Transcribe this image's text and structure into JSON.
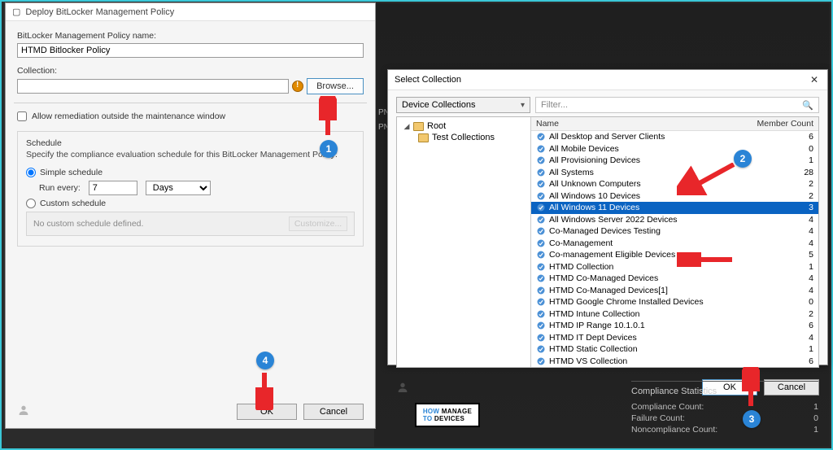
{
  "deploy": {
    "title": "Deploy BitLocker Management Policy",
    "policy_name_label": "BitLocker Management Policy name:",
    "policy_name_value": "HTMD Bitlocker Policy",
    "collection_label": "Collection:",
    "collection_value": "",
    "browse_btn": "Browse...",
    "allow_remediation": "Allow remediation outside the maintenance window",
    "schedule_title": "Schedule",
    "schedule_desc": "Specify the compliance evaluation schedule for this BitLocker Management Policy:",
    "simple_schedule": "Simple schedule",
    "run_every_label": "Run every:",
    "run_every_value": "7",
    "run_every_unit": "Days",
    "custom_schedule": "Custom schedule",
    "no_custom": "No custom schedule defined.",
    "customize_btn": "Customize...",
    "ok": "OK",
    "cancel": "Cancel"
  },
  "select": {
    "title": "Select Collection",
    "dropdown": "Device Collections",
    "filter_placeholder": "Filter...",
    "tree_root": "Root",
    "tree_child": "Test Collections",
    "col_name": "Name",
    "col_count": "Member Count",
    "rows": [
      {
        "name": "All Desktop and Server Clients",
        "count": 6
      },
      {
        "name": "All Mobile Devices",
        "count": 0
      },
      {
        "name": "All Provisioning Devices",
        "count": 1
      },
      {
        "name": "All Systems",
        "count": 28
      },
      {
        "name": "All Unknown Computers",
        "count": 2
      },
      {
        "name": "All Windows 10 Devices",
        "count": 2
      },
      {
        "name": "All Windows 11 Devices",
        "count": 3,
        "selected": true
      },
      {
        "name": "All Windows Server 2022 Devices",
        "count": 4
      },
      {
        "name": "Co-Managed Devices Testing",
        "count": 4
      },
      {
        "name": "Co-Management",
        "count": 4
      },
      {
        "name": "Co-management Eligible Devices",
        "count": 5
      },
      {
        "name": "HTMD Collection",
        "count": 1
      },
      {
        "name": "HTMD Co-Managed Devices",
        "count": 4
      },
      {
        "name": "HTMD Co-Managed Devices[1]",
        "count": 4
      },
      {
        "name": "HTMD Google Chrome Installed Devices",
        "count": 0
      },
      {
        "name": "HTMD Intune Collection",
        "count": 2
      },
      {
        "name": "HTMD IP Range 10.1.0.1",
        "count": 6
      },
      {
        "name": "HTMD IT Dept Devices",
        "count": 4
      },
      {
        "name": "HTMD Static Collection",
        "count": 1
      },
      {
        "name": "HTMD VS Collection",
        "count": 6
      }
    ],
    "ok": "OK",
    "cancel": "Cancel"
  },
  "compliance": {
    "title": "Compliance Statistics",
    "rows": [
      {
        "label": "Compliance Count:",
        "value": "1"
      },
      {
        "label": "Failure Count:",
        "value": "0"
      },
      {
        "label": "Noncompliance Count:",
        "value": "1"
      }
    ]
  },
  "callouts": {
    "c1": "1",
    "c2": "2",
    "c3": "3",
    "c4": "4"
  },
  "logo_text": "HOW TO MANAGE DEVICES"
}
